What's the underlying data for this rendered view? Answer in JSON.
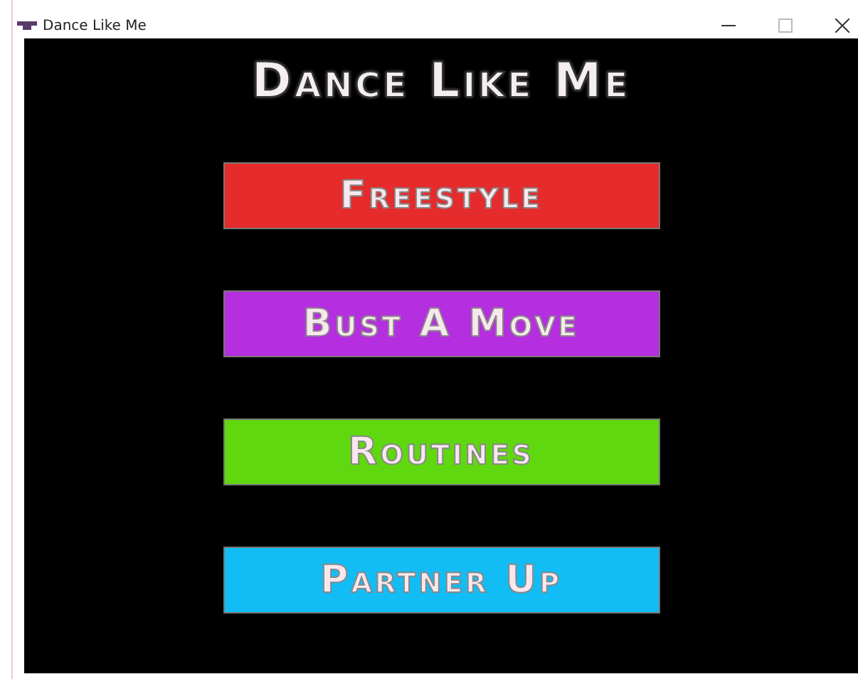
{
  "window": {
    "title": "Dance Like Me"
  },
  "game": {
    "title": "Dance Like Me",
    "menu_buttons": [
      {
        "label": "Freestyle",
        "color": "#e52b2b"
      },
      {
        "label": "Bust A Move",
        "color": "#b52ee0"
      },
      {
        "label": "Routines",
        "color": "#5fd80f"
      },
      {
        "label": "Partner Up",
        "color": "#12bdf5"
      }
    ]
  }
}
